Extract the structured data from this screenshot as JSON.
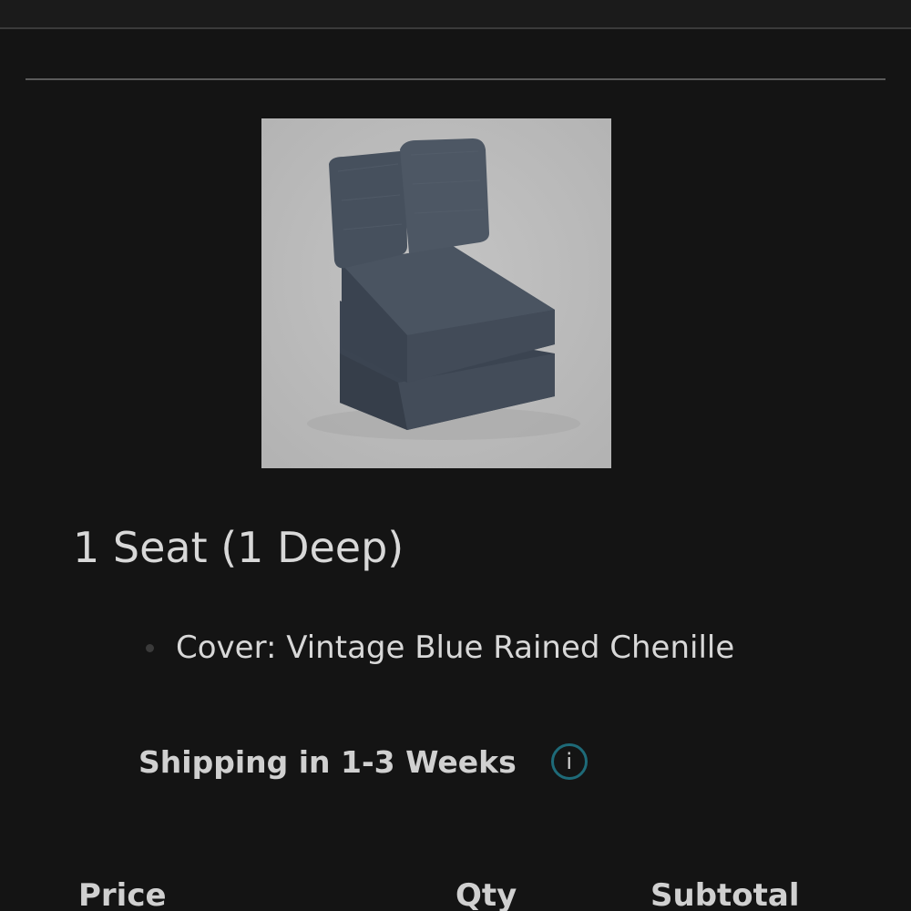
{
  "product": {
    "title": "1 Seat (1 Deep)",
    "image_alt": "chair-product-photo",
    "options": [
      {
        "text": "Cover: Vintage Blue Rained Chenille"
      }
    ]
  },
  "shipping": {
    "text": "Shipping in 1-3 Weeks",
    "info_glyph": "i"
  },
  "table": {
    "headers": {
      "price": "Price",
      "qty": "Qty",
      "subtotal": "Subtotal"
    }
  },
  "colors": {
    "background": "#141414",
    "image_background": "#b9b9b9",
    "info_ring": "#1e6a78"
  }
}
